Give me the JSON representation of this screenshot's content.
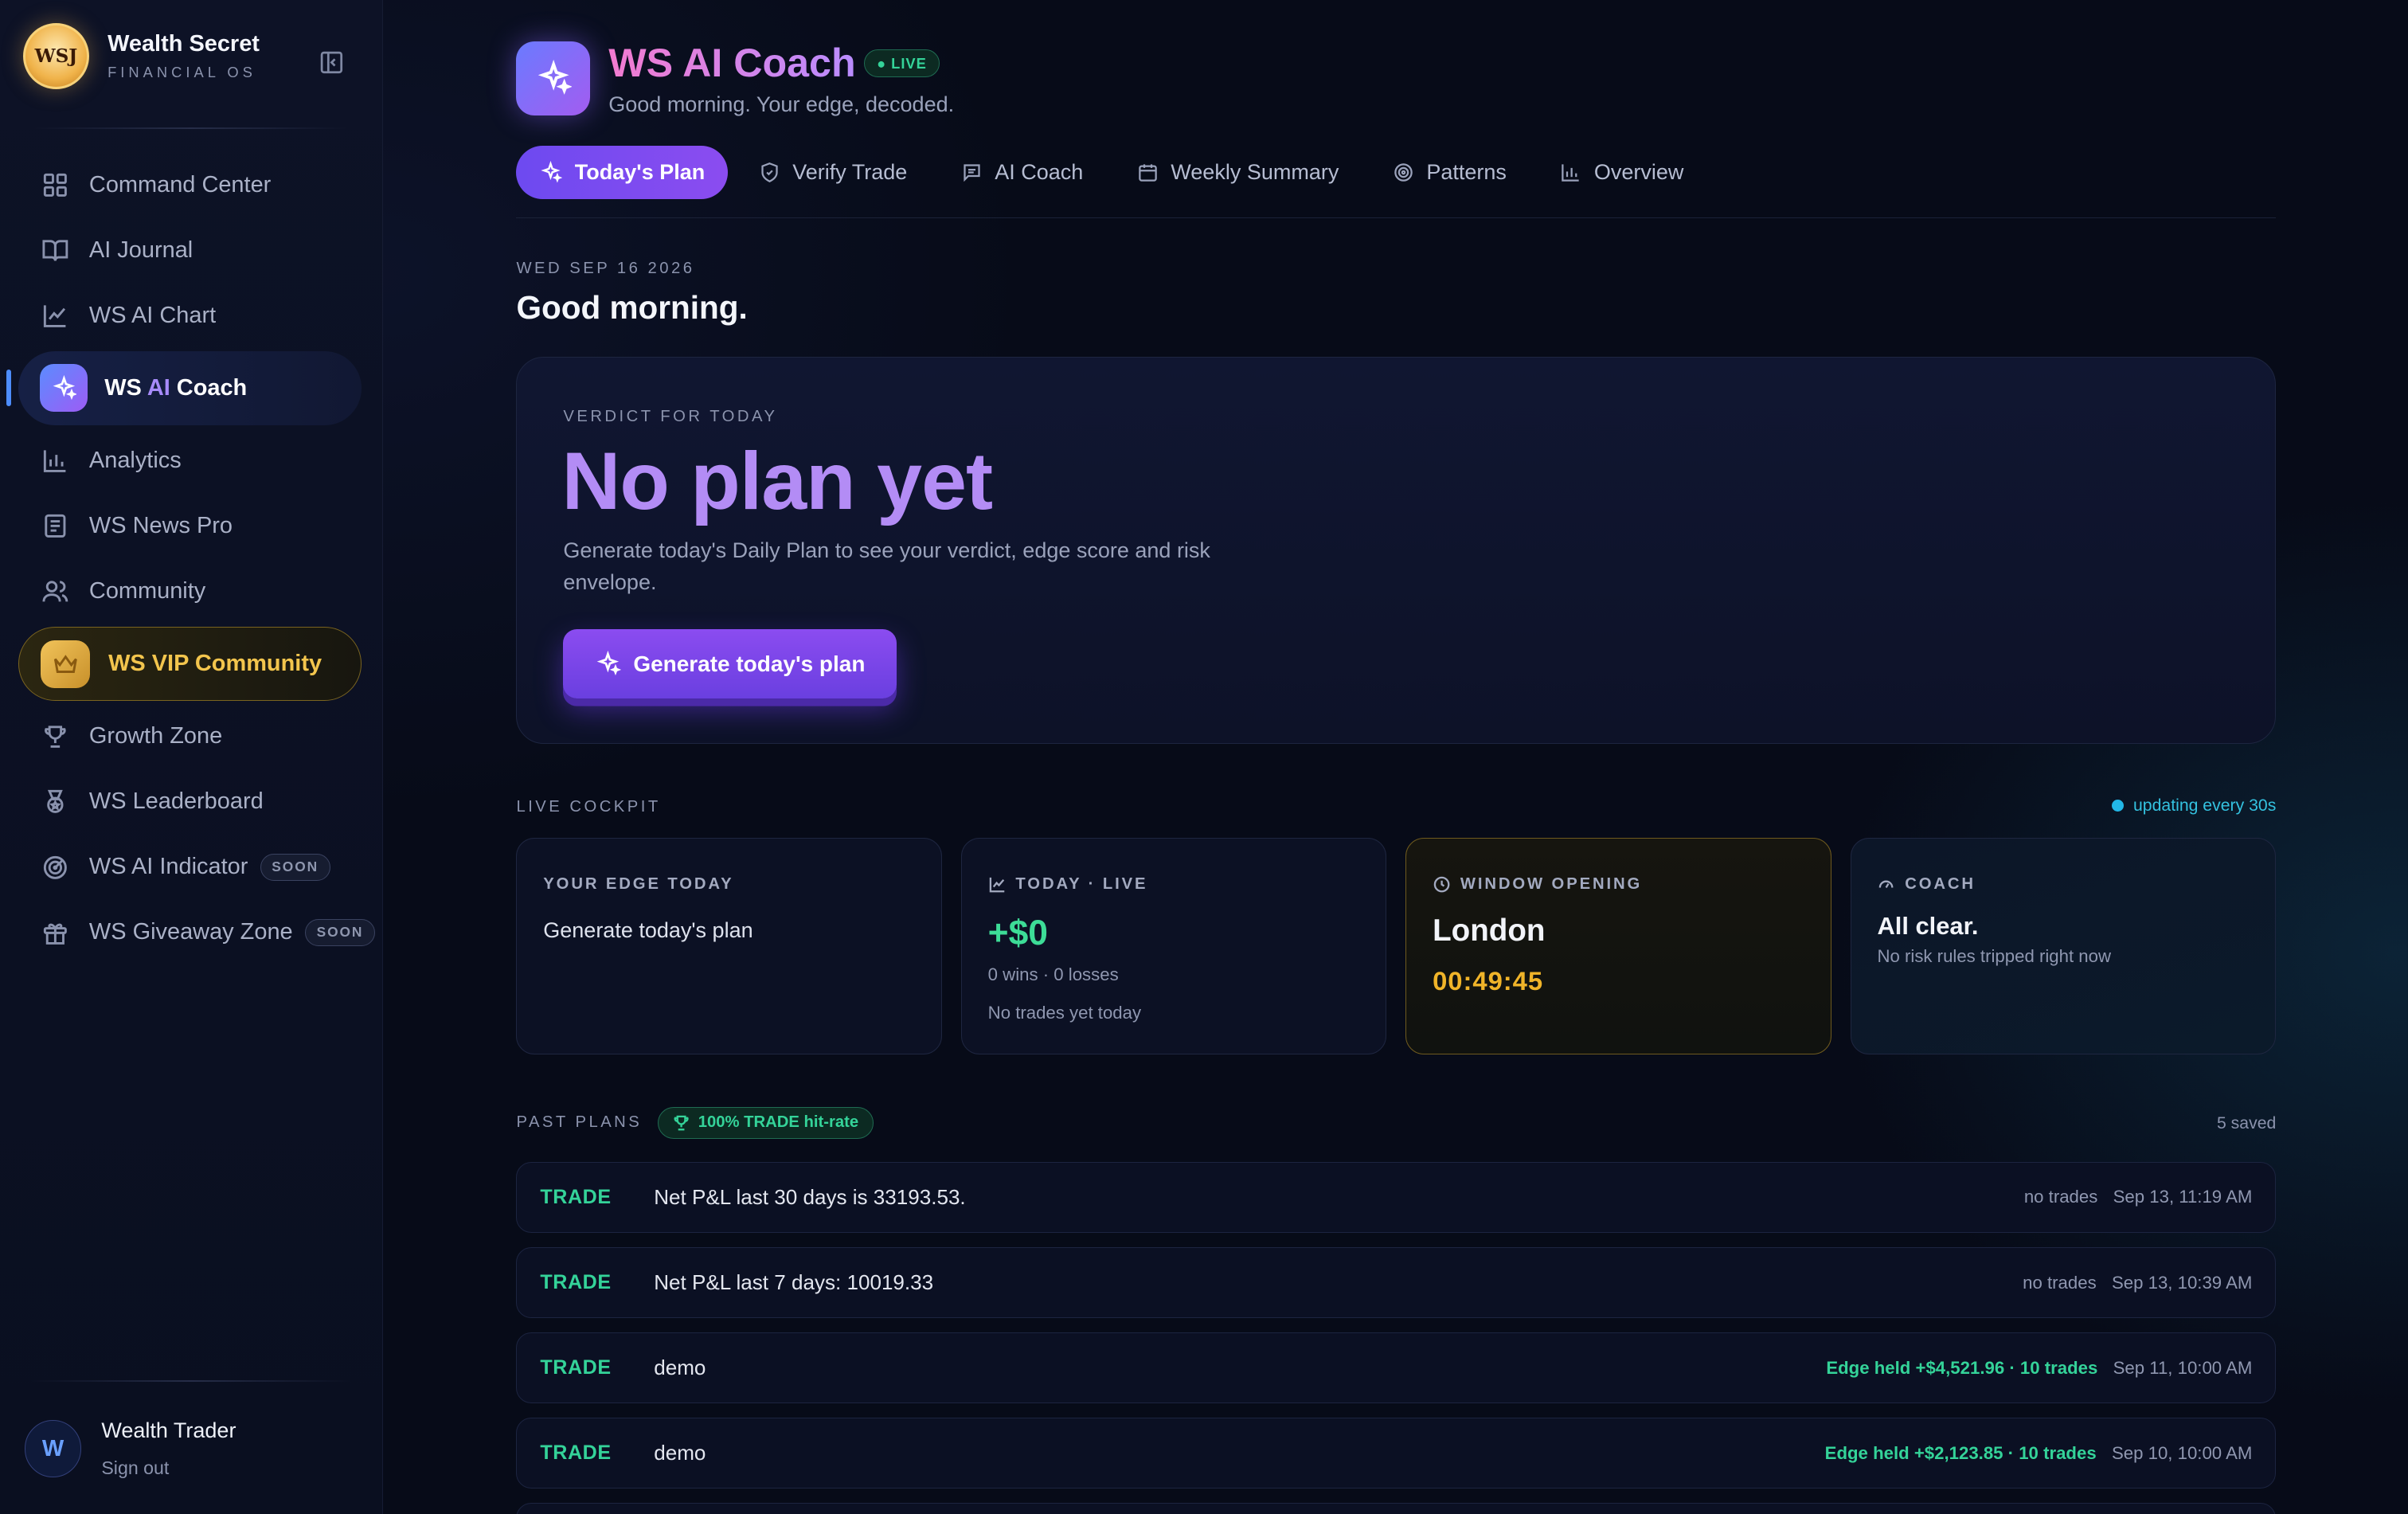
{
  "brand": {
    "title": "Wealth Secret",
    "subtitle": "FINANCIAL OS",
    "logo_text": "WSJ"
  },
  "sidebar": {
    "items": [
      {
        "label": "Command Center",
        "icon": "grid-icon"
      },
      {
        "label": "AI Journal",
        "icon": "book-icon"
      },
      {
        "label": "WS AI Chart",
        "icon": "line-chart-icon"
      },
      {
        "label_prefix": "WS ",
        "label_ai": "AI",
        "label_suffix": " Coach",
        "icon": "sparkle-icon",
        "active": true
      },
      {
        "label": "Analytics",
        "icon": "bar-chart-icon"
      },
      {
        "label": "WS News Pro",
        "icon": "newspaper-icon"
      },
      {
        "label": "Community",
        "icon": "users-icon"
      },
      {
        "label": "WS VIP Community",
        "icon": "crown-icon",
        "vip": true
      },
      {
        "label": "Growth Zone",
        "icon": "trophy-icon"
      },
      {
        "label": "WS Leaderboard",
        "icon": "medal-icon"
      },
      {
        "label": "WS AI Indicator",
        "icon": "radar-icon",
        "badge": "SOON"
      },
      {
        "label": "WS Giveaway Zone",
        "icon": "gift-icon",
        "badge": "SOON"
      }
    ]
  },
  "user": {
    "initial": "W",
    "name": "Wealth Trader",
    "signout": "Sign out"
  },
  "header": {
    "title": "WS AI Coach",
    "live": "LIVE",
    "subtitle": "Good morning. Your edge, decoded."
  },
  "tabs": [
    {
      "label": "Today's Plan",
      "icon": "sparkle-icon",
      "selected": true
    },
    {
      "label": "Verify Trade",
      "icon": "shield-icon"
    },
    {
      "label": "AI Coach",
      "icon": "message-icon"
    },
    {
      "label": "Weekly Summary",
      "icon": "calendar-icon"
    },
    {
      "label": "Patterns",
      "icon": "target-icon"
    },
    {
      "label": "Overview",
      "icon": "bar-chart-icon"
    }
  ],
  "today": {
    "date": "WED SEP 16 2026",
    "greeting": "Good morning."
  },
  "verdict": {
    "label": "VERDICT FOR TODAY",
    "title": "No plan yet",
    "description": "Generate today's Daily Plan to see your verdict, edge score and risk envelope.",
    "button": "Generate today's plan"
  },
  "cockpit": {
    "label": "LIVE COCKPIT",
    "updating": "updating every 30s",
    "edge": {
      "label": "YOUR EDGE TODAY",
      "text": "Generate today's plan"
    },
    "today": {
      "label": "TODAY · LIVE",
      "pnl": "+$0",
      "record": "0 wins · 0 losses",
      "note": "No trades yet today"
    },
    "window": {
      "label": "WINDOW OPENING",
      "city": "London",
      "countdown": "00:49:45"
    },
    "coach": {
      "label": "COACH",
      "status": "All clear.",
      "note": "No risk rules tripped right now"
    }
  },
  "past_plans": {
    "label": "PAST PLANS",
    "hit_rate": "100% TRADE hit-rate",
    "saved": "5 saved",
    "rows": [
      {
        "tag": "TRADE",
        "text": "Net P&L last 30 days is 33193.53.",
        "stat": "no trades",
        "time": "Sep 13, 11:19 AM"
      },
      {
        "tag": "TRADE",
        "text": "Net P&L last 7 days: 10019.33",
        "stat": "no trades",
        "time": "Sep 13, 10:39 AM"
      },
      {
        "tag": "TRADE",
        "text": "demo",
        "stat": "Edge held +$4,521.96 · 10 trades",
        "time": "Sep 11, 10:00 AM"
      },
      {
        "tag": "TRADE",
        "text": "demo",
        "stat": "Edge held +$2,123.85 · 10 trades",
        "time": "Sep 10, 10:00 AM"
      }
    ]
  },
  "colors": {
    "accent": "#8b4cf0",
    "positive": "#34d399",
    "gold": "#f0b429",
    "background": "#070b18"
  }
}
